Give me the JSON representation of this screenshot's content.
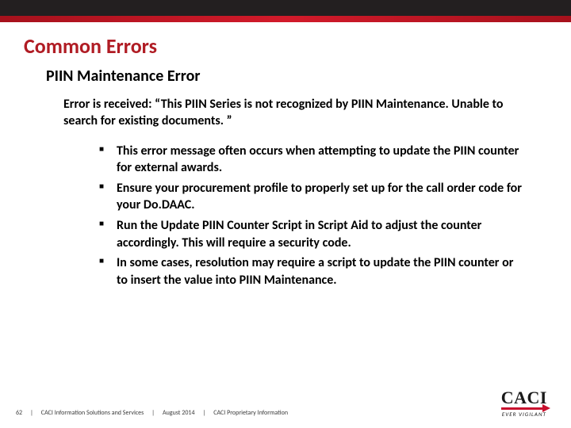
{
  "header": {
    "title": "Common Errors",
    "subtitle": "PIIN Maintenance Error"
  },
  "body": {
    "error_received": "Error is received: “This PIIN Series is not recognized by PIIN Maintenance. Unable to search for existing documents. ”",
    "bullets": [
      "This error message often occurs when attempting to update the PIIN counter for external awards.",
      "Ensure your procurement profile to properly set up for the call order code for your Do.DAAC.",
      "Run the Update PIIN Counter Script in Script Aid to adjust the counter accordingly. This will require a security code.",
      "In some cases, resolution may require a script to update the PIIN counter or to insert the value into PIIN Maintenance."
    ]
  },
  "footer": {
    "page_number": "62",
    "org": "CACI Information Solutions and Services",
    "date": "August 2014",
    "classification": "CACI Proprietary Information",
    "logo_text": "CACI",
    "logo_tagline": "EVER VIGILANT"
  }
}
